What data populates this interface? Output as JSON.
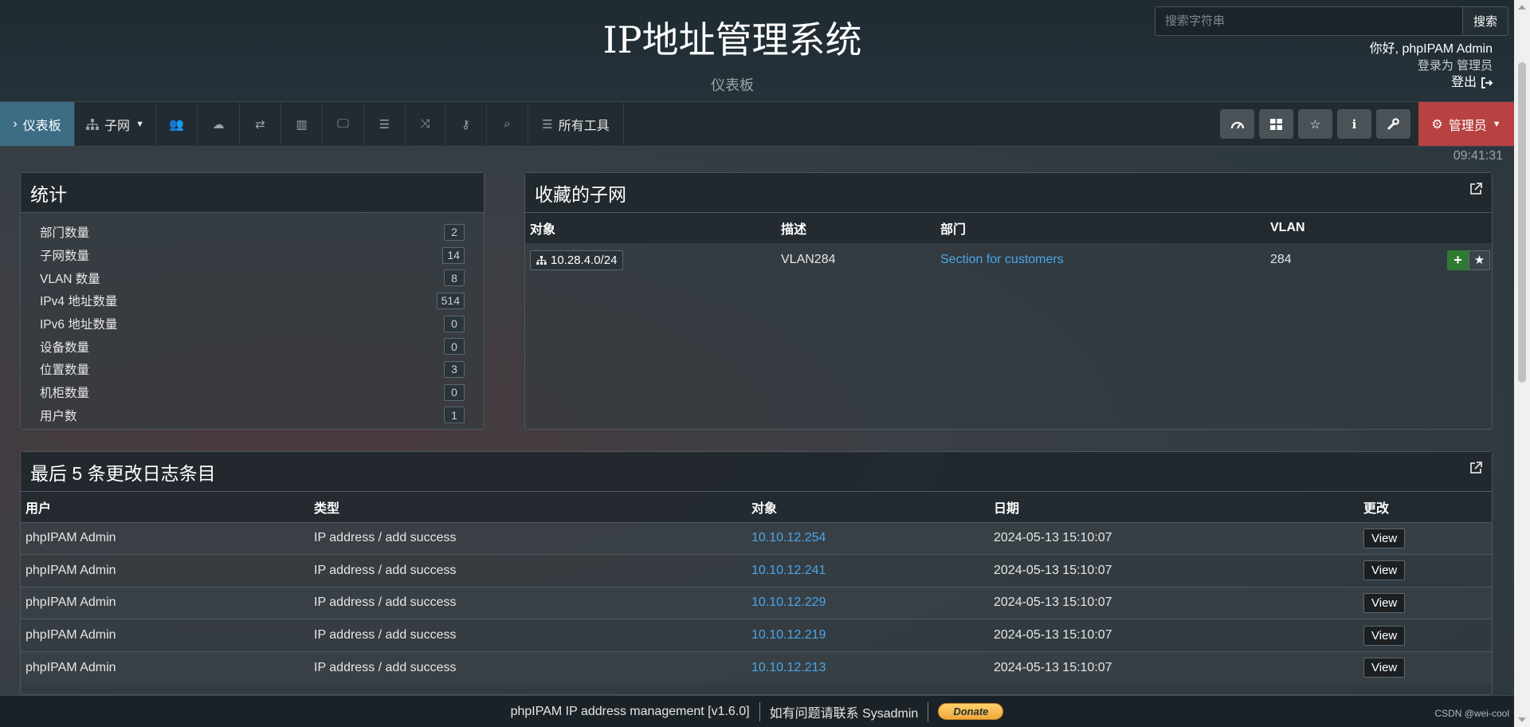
{
  "header": {
    "title": "IP地址管理系统",
    "subtitle": "仪表板",
    "search_placeholder": "搜索字符串",
    "search_button": "搜索",
    "greeting": "你好, phpIPAM Admin",
    "role": "登录为  管理员",
    "logout": "登出"
  },
  "nav": {
    "dashboard": "仪表板",
    "subnets": "子网",
    "all_tools": "所有工具",
    "admin": "管理员",
    "icons": [
      "users-icon",
      "cloud-icon",
      "exchange-icon",
      "map-icon",
      "monitor-icon",
      "list-icon",
      "random-icon",
      "key-icon",
      "search-icon"
    ]
  },
  "clock": "09:41:31",
  "stats": {
    "title": "统计",
    "items": [
      {
        "label": "部门数量",
        "value": "2"
      },
      {
        "label": "子网数量",
        "value": "14"
      },
      {
        "label": "VLAN 数量",
        "value": "8"
      },
      {
        "label": "IPv4 地址数量",
        "value": "514"
      },
      {
        "label": "IPv6 地址数量",
        "value": "0"
      },
      {
        "label": "设备数量",
        "value": "0"
      },
      {
        "label": "位置数量",
        "value": "3"
      },
      {
        "label": "机柜数量",
        "value": "0"
      },
      {
        "label": "用户数",
        "value": "1"
      }
    ]
  },
  "favorites": {
    "title": "收藏的子网",
    "columns": [
      "对象",
      "描述",
      "部门",
      "VLAN"
    ],
    "rows": [
      {
        "object": "10.28.4.0/24",
        "description": "VLAN284",
        "section": "Section for customers",
        "vlan": "284"
      }
    ]
  },
  "changelog": {
    "title": "最后 5 条更改日志条目",
    "columns": [
      "用户",
      "类型",
      "对象",
      "日期",
      "更改"
    ],
    "view_label": "View",
    "rows": [
      {
        "user": "phpIPAM Admin",
        "type": "IP address / add success",
        "object": "10.10.12.254",
        "date": "2024-05-13 15:10:07"
      },
      {
        "user": "phpIPAM Admin",
        "type": "IP address / add success",
        "object": "10.10.12.241",
        "date": "2024-05-13 15:10:07"
      },
      {
        "user": "phpIPAM Admin",
        "type": "IP address / add success",
        "object": "10.10.12.229",
        "date": "2024-05-13 15:10:07"
      },
      {
        "user": "phpIPAM Admin",
        "type": "IP address / add success",
        "object": "10.10.12.219",
        "date": "2024-05-13 15:10:07"
      },
      {
        "user": "phpIPAM Admin",
        "type": "IP address / add success",
        "object": "10.10.12.213",
        "date": "2024-05-13 15:10:07"
      }
    ]
  },
  "footer": {
    "version": "phpIPAM IP address management [v1.6.0]",
    "contact": "如有问题请联系 Sysadmin",
    "donate": "Donate",
    "watermark": "CSDN @wei-cool"
  }
}
